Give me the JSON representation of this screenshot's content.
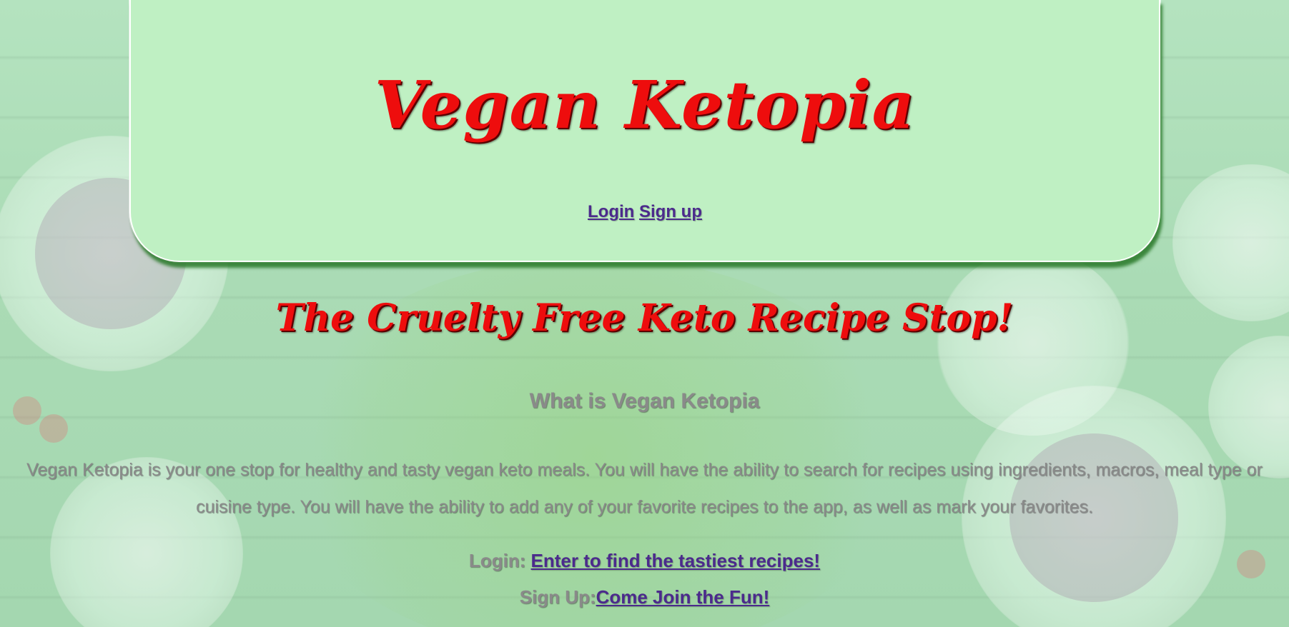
{
  "header": {
    "site_title": "Vegan Ketopia",
    "nav": {
      "login": "Login",
      "signup": "Sign up"
    }
  },
  "main": {
    "tagline": "The Cruelty Free Keto Recipe Stop!",
    "about_heading": "What is Vegan Ketopia",
    "about_text": "Vegan Ketopia is your one stop for healthy and tasty vegan keto meals. You will have the ability to search for recipes using ingredients, macros, meal type or cuisine type. You will have the ability to add any of your favorite recipes to the app, as well as mark your favorites.",
    "login_cta": {
      "label": "Login: ",
      "link": "Enter to find the tastiest recipes!"
    },
    "signup_cta": {
      "label": "Sign Up:",
      "link": "Come Join the Fun!"
    }
  },
  "colors": {
    "title_red": "#ee0d0d",
    "header_bg": "#bff0c3",
    "link_purple": "#4b2a8c",
    "body_text": "#8a8a8a"
  }
}
